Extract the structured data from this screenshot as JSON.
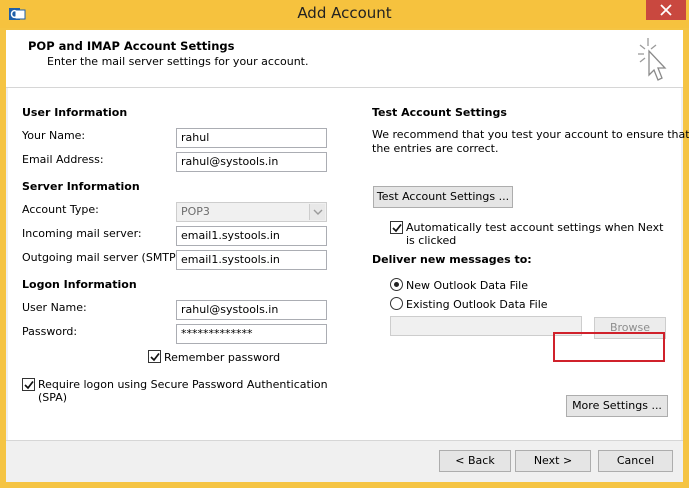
{
  "window": {
    "title": "Add Account"
  },
  "header": {
    "title": "POP and IMAP Account Settings",
    "subtitle": "Enter the mail server settings for your account."
  },
  "left": {
    "user_info_heading": "User Information",
    "your_name_label": "Your Name:",
    "your_name_value": "rahul",
    "email_label": "Email Address:",
    "email_value": "rahul@systools.in",
    "server_info_heading": "Server Information",
    "account_type_label": "Account Type:",
    "account_type_value": "POP3",
    "incoming_label": "Incoming mail server:",
    "incoming_value": "email1.systools.in",
    "outgoing_label": "Outgoing mail server (SMTP):",
    "outgoing_value": "email1.systools.in",
    "logon_heading": "Logon Information",
    "username_label": "User Name:",
    "username_value": "rahul@systools.in",
    "password_label": "Password:",
    "password_value": "*************",
    "remember_label": "Remember password",
    "remember_checked": true,
    "spa_label_line1": "Require logon using Secure Password Authentication",
    "spa_label_line2": "(SPA)",
    "spa_checked": true
  },
  "right": {
    "test_heading": "Test Account Settings",
    "test_desc_line1": "We recommend that you test your account to ensure that",
    "test_desc_line2": "the entries are correct.",
    "test_button": "Test Account Settings ...",
    "auto_test_line1": "Automatically test account settings when Next",
    "auto_test_line2": "is clicked",
    "auto_test_checked": true,
    "deliver_heading": "Deliver new messages to:",
    "new_data_file": "New Outlook Data File",
    "existing_data_file": "Existing Outlook Data File",
    "selected_delivery": "new",
    "browse_button": "Browse",
    "more_settings_button": "More Settings ..."
  },
  "footer": {
    "back_button": "< Back",
    "next_button": "Next >",
    "cancel_button": "Cancel"
  },
  "colors": {
    "title_bar": "#f6c23e",
    "close_button": "#c9483f",
    "highlight_border": "#d0212b"
  }
}
